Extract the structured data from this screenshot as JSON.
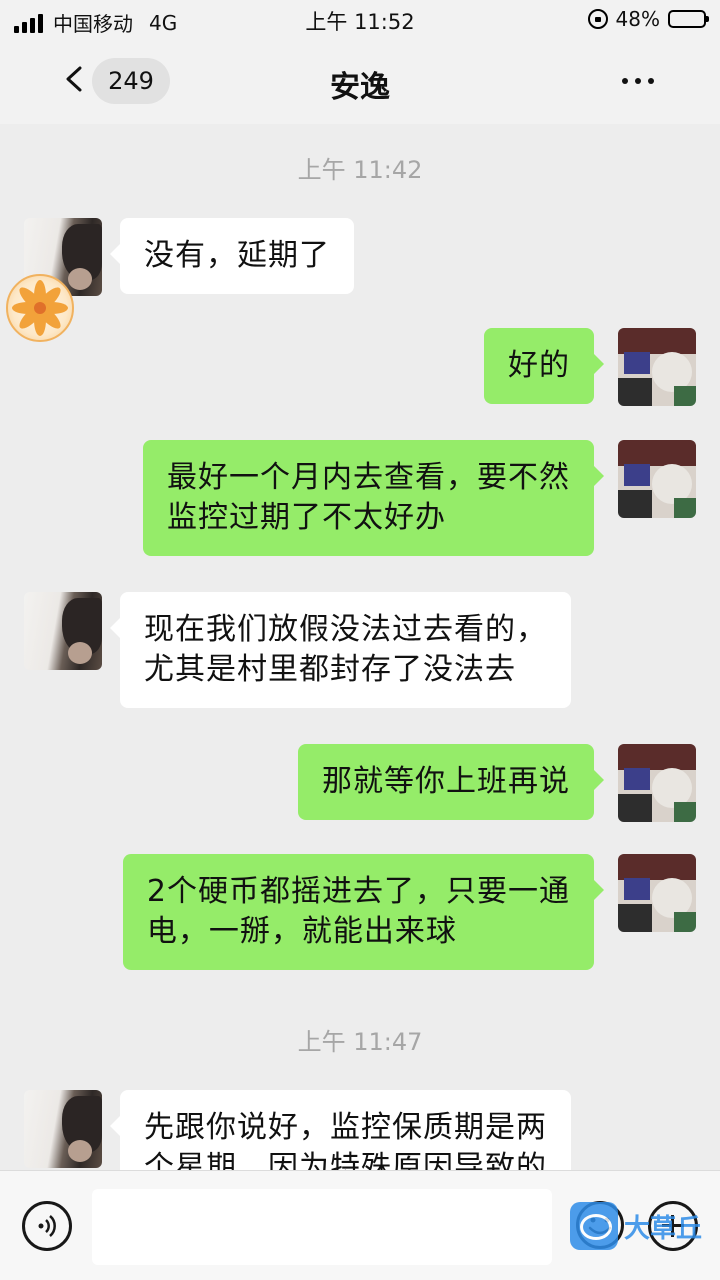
{
  "status_bar": {
    "carrier": "中国移动",
    "network": "4G",
    "time": "上午 11:52",
    "battery_percent": "48%",
    "battery_level": 0.48
  },
  "nav": {
    "unread_count": "249",
    "title": "安逸"
  },
  "messages": [
    {
      "type": "timestamp",
      "text": "上午 11:42"
    },
    {
      "type": "in",
      "text": "没有，延期了"
    },
    {
      "type": "out",
      "text": "好的"
    },
    {
      "type": "out",
      "lines": [
        "最好一个月内去查看，要不然",
        "监控过期了不太好办"
      ]
    },
    {
      "type": "in",
      "lines": [
        "现在我们放假没法过去看的，",
        "尤其是村里都封存了没法去"
      ]
    },
    {
      "type": "out",
      "text": "那就等你上班再说"
    },
    {
      "type": "out",
      "lines": [
        "2个硬币都摇进去了，只要一通",
        "电，一掰，就能出来球"
      ]
    },
    {
      "type": "timestamp",
      "text": "上午 11:47"
    },
    {
      "type": "in",
      "lines": [
        "先跟你说好，监控保质期是两",
        "个星期，因为特殊原因导致的"
      ]
    }
  ],
  "input_bar": {
    "placeholder": "",
    "watermark": "大草丘"
  },
  "colors": {
    "outgoing_bubble": "#95ec69",
    "incoming_bubble": "#ffffff",
    "background": "#ededed"
  }
}
